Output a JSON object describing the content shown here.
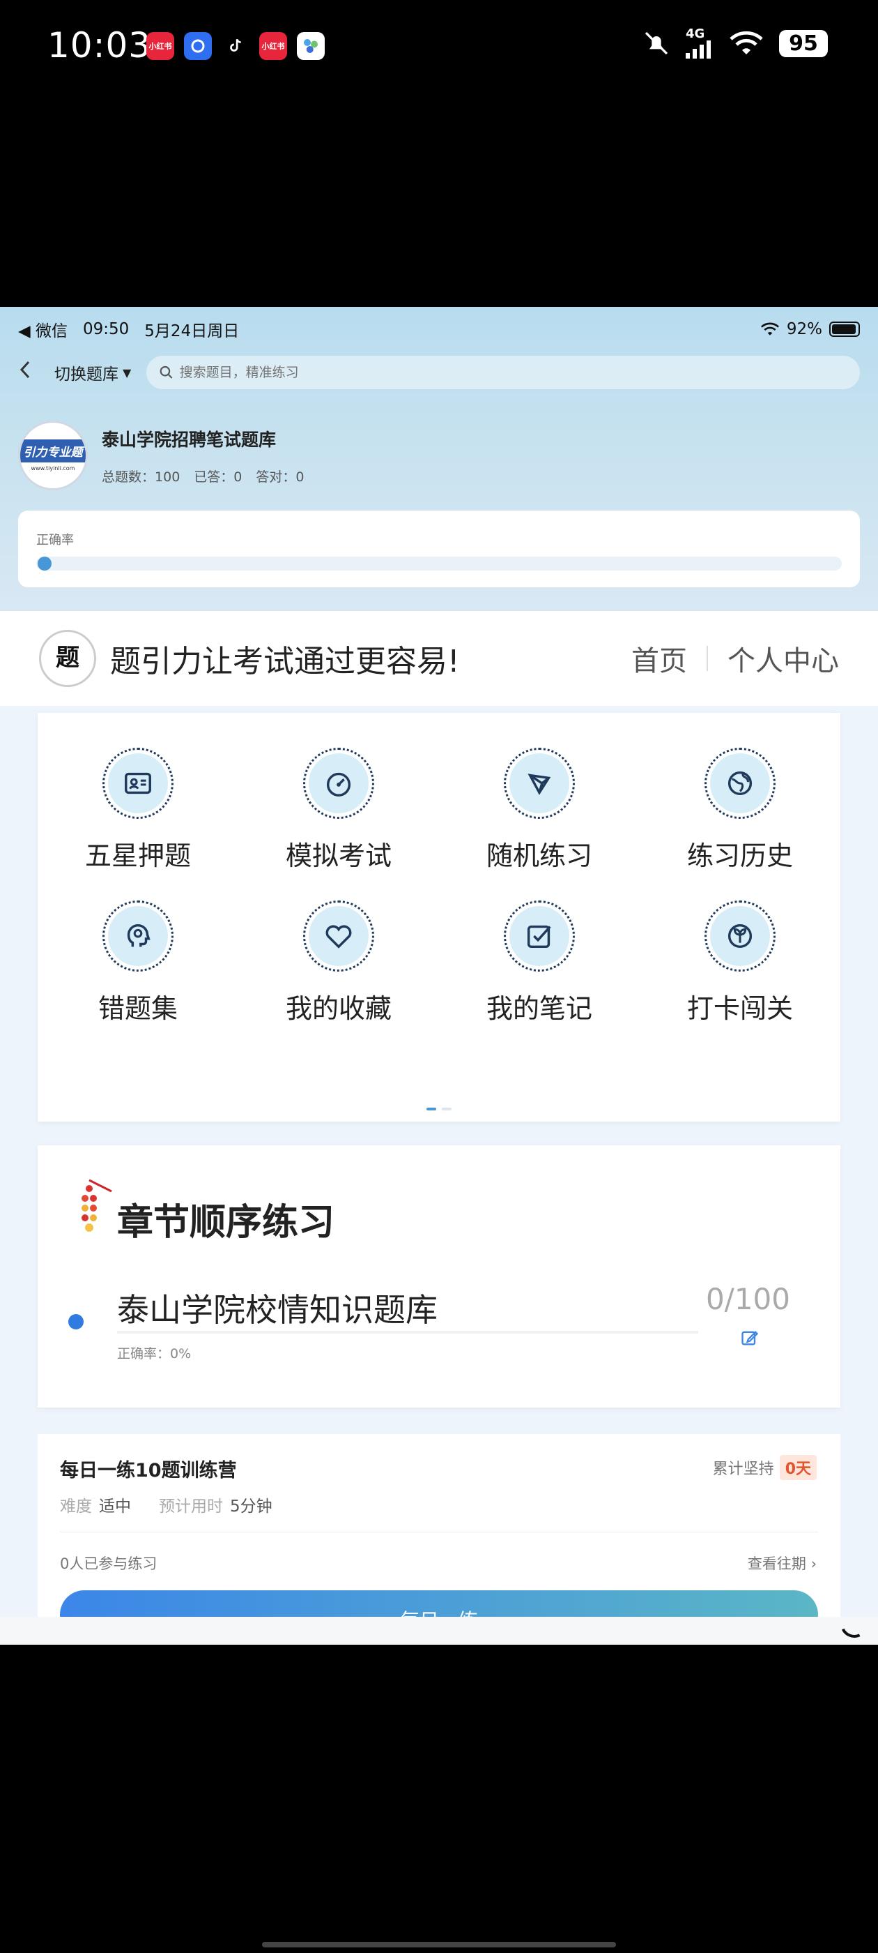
{
  "phone_status": {
    "time": "10:03",
    "apps": [
      {
        "name": "xiaohongshu",
        "label": "小红书",
        "color": "#e8263b"
      },
      {
        "name": "shield-app",
        "label": "",
        "color": "#2f6ef0"
      },
      {
        "name": "tiktok",
        "label": "",
        "color": "#000000"
      },
      {
        "name": "xiaohongshu",
        "label": "小红书",
        "color": "#e8263b"
      },
      {
        "name": "cluster-app",
        "label": "",
        "color": "#ffffff"
      }
    ],
    "network": "4G",
    "battery": "95"
  },
  "inner_status": {
    "back_app": "◀ 微信",
    "time": "09:50",
    "date": "5月24日周日",
    "battery": "92%"
  },
  "nav": {
    "switch_label": "切换题库",
    "search_placeholder": "搜索题目，精准练习"
  },
  "bank": {
    "logo_text": "引力专业题",
    "logo_small": "www.tiyinli.com",
    "title": "泰山学院招聘笔试题库",
    "total_label": "总题数：",
    "total": "100",
    "answered_label": "已答：",
    "answered": "0",
    "correct_label": "答对：",
    "correct": "0",
    "accuracy_label": "正确率",
    "accuracy": 0
  },
  "site_header": {
    "logo_text": "题引力",
    "slogan": "题引力让考试通过更容易!",
    "nav_home": "首页",
    "nav_center": "个人中心"
  },
  "grid": [
    {
      "label": "五星押题",
      "icon": "id-card-icon"
    },
    {
      "label": "模拟考试",
      "icon": "speedometer-icon"
    },
    {
      "label": "随机练习",
      "icon": "network-icon"
    },
    {
      "label": "练习历史",
      "icon": "globe-icon"
    },
    {
      "label": "错题集",
      "icon": "head-icon"
    },
    {
      "label": "我的收藏",
      "icon": "heart-icon"
    },
    {
      "label": "我的笔记",
      "icon": "check-square-icon"
    },
    {
      "label": "打卡闯关",
      "icon": "sprout-icon"
    }
  ],
  "chapter": {
    "title": "章节顺序练习",
    "name": "泰山学院校情知识题库",
    "accuracy": "正确率：0%",
    "count": "0/100"
  },
  "daily": {
    "title": "每日一练10题训练营",
    "persist_label": "累计坚持",
    "persist_days": "0天",
    "difficulty_label": "难度",
    "difficulty": "适中",
    "time_label": "预计用时",
    "time": "5分钟",
    "participants": "0人已参与练习",
    "past": "查看往期 ›",
    "button": "每日一练"
  },
  "colors": {
    "accent": "#4797d8",
    "chapter_dot": "#2f7be0",
    "badge": "#e0562d"
  }
}
